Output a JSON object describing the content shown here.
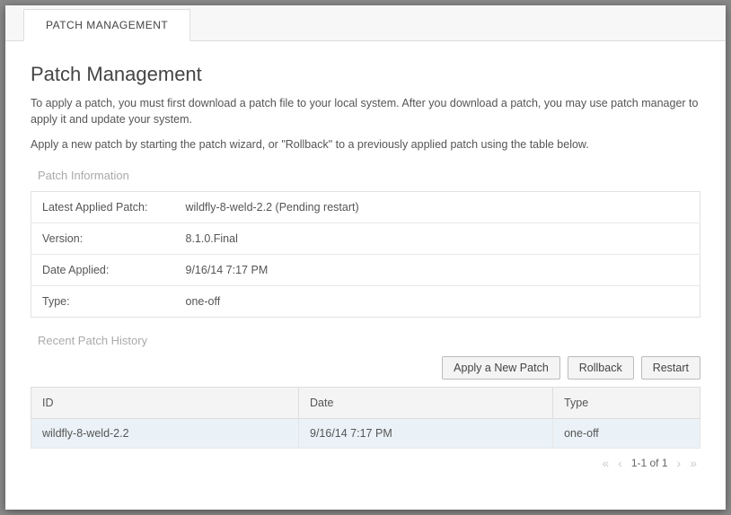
{
  "tabs": {
    "patch_management": "PATCH MANAGEMENT"
  },
  "page": {
    "title": "Patch Management",
    "desc1": "To apply a patch, you must first download a patch file to your local system. After you download a patch, you may use patch manager to apply it and update your system.",
    "desc2": "Apply a new patch by starting the patch wizard, or \"Rollback\" to a previously applied patch using the table below."
  },
  "patch_info": {
    "section_title": "Patch Information",
    "rows": [
      {
        "label": "Latest Applied Patch:",
        "value": "wildfly-8-weld-2.2 (Pending restart)"
      },
      {
        "label": "Version:",
        "value": "8.1.0.Final"
      },
      {
        "label": "Date Applied:",
        "value": "9/16/14 7:17 PM"
      },
      {
        "label": "Type:",
        "value": "one-off"
      }
    ]
  },
  "history": {
    "section_title": "Recent Patch History",
    "actions": {
      "apply": "Apply a New Patch",
      "rollback": "Rollback",
      "restart": "Restart"
    },
    "columns": {
      "id": "ID",
      "date": "Date",
      "type": "Type"
    },
    "rows": [
      {
        "id": "wildfly-8-weld-2.2",
        "date": "9/16/14 7:17 PM",
        "type": "one-off"
      }
    ],
    "pager": "1-1 of 1"
  }
}
